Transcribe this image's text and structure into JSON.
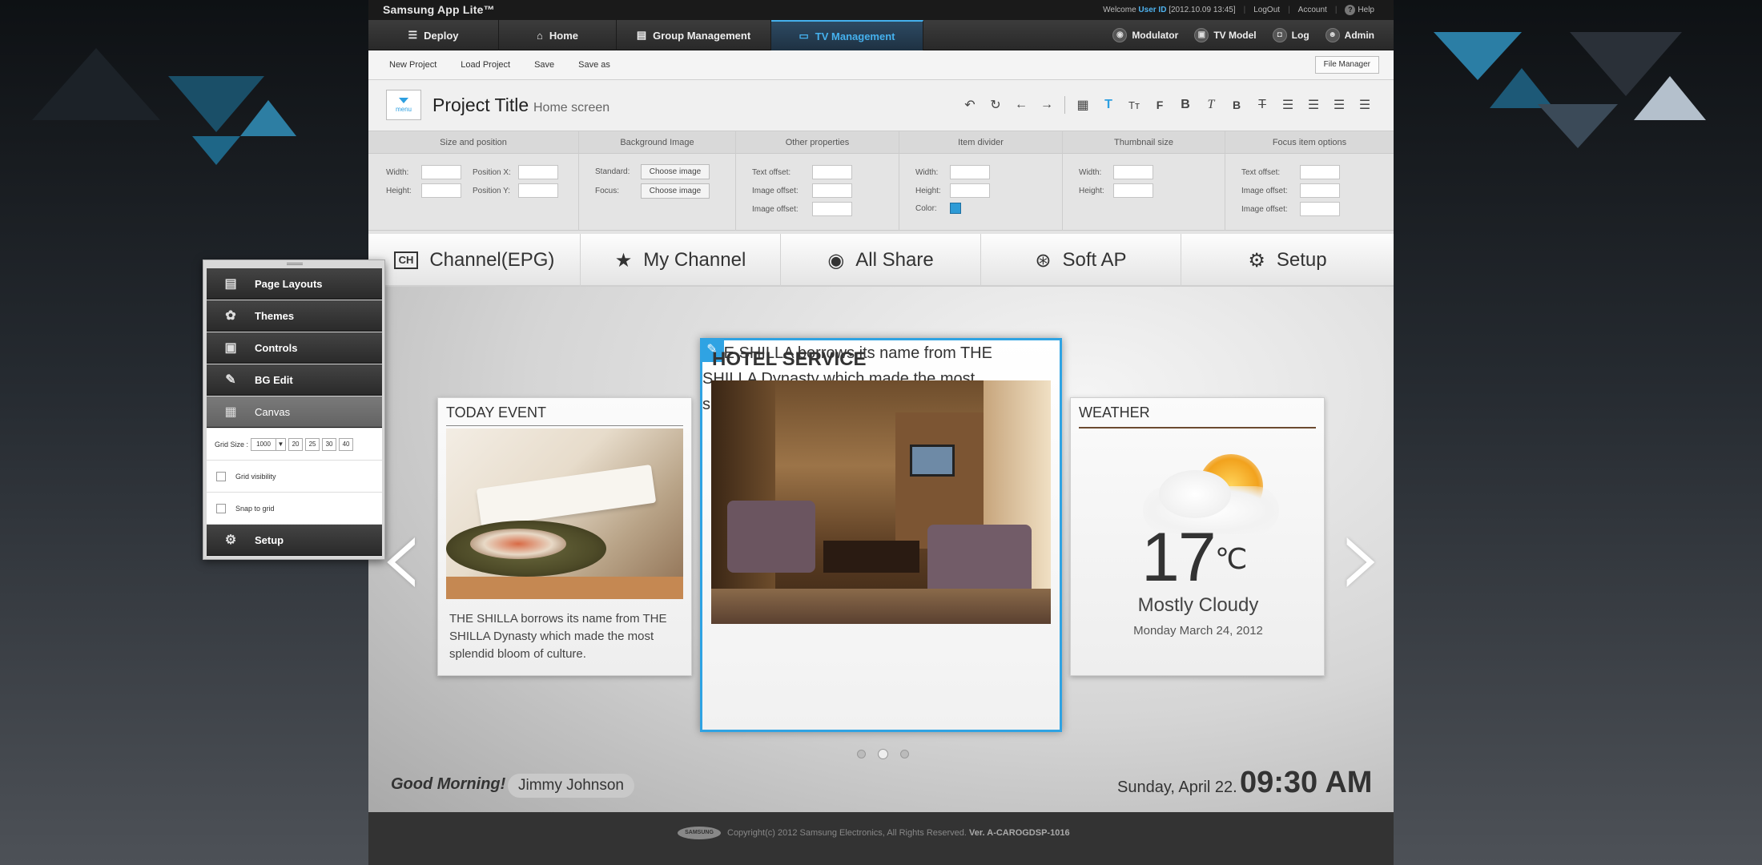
{
  "app": {
    "brand": "Samsung App Lite™",
    "welcome_prefix": "Welcome",
    "user_id": "User ID",
    "timestamp": "[2012.10.09 13:45]",
    "logout": "LogOut",
    "account": "Account",
    "help": "Help"
  },
  "nav": {
    "tabs": [
      {
        "label": "Deploy",
        "icon": "stack-icon"
      },
      {
        "label": "Home",
        "icon": "home-icon"
      },
      {
        "label": "Group Management",
        "icon": "document-icon"
      },
      {
        "label": "TV Management",
        "icon": "tv-icon",
        "active": true
      }
    ],
    "right": [
      {
        "label": "Modulator",
        "icon": "modulator-icon"
      },
      {
        "label": "TV Model",
        "icon": "tv-model-icon"
      },
      {
        "label": "Log",
        "icon": "lock-icon"
      },
      {
        "label": "Admin",
        "icon": "user-icon"
      }
    ]
  },
  "toolbar": {
    "new_project": "New Project",
    "load_project": "Load Project",
    "save": "Save",
    "save_as": "Save as",
    "file_manager": "File Manager"
  },
  "project": {
    "menu_label": "menu",
    "title": "Project Title",
    "subtitle": "Home screen"
  },
  "properties": {
    "size": {
      "head": "Size and position",
      "width": "Width:",
      "height": "Height:",
      "posx": "Position X:",
      "posy": "Position Y:"
    },
    "bg": {
      "head": "Background Image",
      "standard": "Standard:",
      "focus": "Focus:",
      "choose": "Choose image"
    },
    "other": {
      "head": "Other properties",
      "text_offset": "Text offset:",
      "image_offset": "Image offset:"
    },
    "divider": {
      "head": "Item divider",
      "width": "Width:",
      "height": "Height:",
      "color": "Color:",
      "color_value": "#2e9bd6"
    },
    "thumb": {
      "head": "Thumbnail size",
      "width": "Width:",
      "height": "Height:"
    },
    "focusopt": {
      "head": "Focus item options",
      "text_offset": "Text offset:",
      "image_offset": "Image offset:"
    }
  },
  "categories": [
    {
      "label": "Channel(EPG)",
      "icon": "ch-icon"
    },
    {
      "label": "My Channel",
      "icon": "tv-star-icon"
    },
    {
      "label": "All Share",
      "icon": "share-icon"
    },
    {
      "label": "Soft AP",
      "icon": "antenna-icon"
    },
    {
      "label": "Setup",
      "icon": "gear-icon"
    }
  ],
  "cards": {
    "event": {
      "title": "TODAY EVENT",
      "desc": "THE SHILLA borrows its name from THE SHILLA Dynasty which made the most splendid bloom of culture."
    },
    "hotel": {
      "title": "HOTEL SERVICE",
      "desc": "THE SHILLA borrows its name from THE SHILLA Dynasty which made the most splendid bloom of culture."
    },
    "weather": {
      "title": "WEATHER",
      "temp": "17",
      "unit": "℃",
      "condition": "Mostly Cloudy",
      "date": "Monday March 24, 2012"
    }
  },
  "status": {
    "greeting": "Good Morning!",
    "user": "Jimmy Johnson",
    "date": "Sunday, April 22.",
    "time": "09:30 AM"
  },
  "footer": {
    "logo": "SAMSUNG",
    "copyright": "Copyright(c) 2012 Samsung Electronics, All Rights Reserved.",
    "version": "Ver. A-CAROGDSP-1016"
  },
  "panel": {
    "items": [
      "Page Layouts",
      "Themes",
      "Controls",
      "BG Edit",
      "Canvas"
    ],
    "grid_size_label": "Grid Size :",
    "grid_size_value": "1000",
    "grid_options": [
      "20",
      "25",
      "30",
      "40"
    ],
    "grid_visibility": "Grid visibility",
    "snap_to_grid": "Snap to grid",
    "setup": "Setup"
  }
}
